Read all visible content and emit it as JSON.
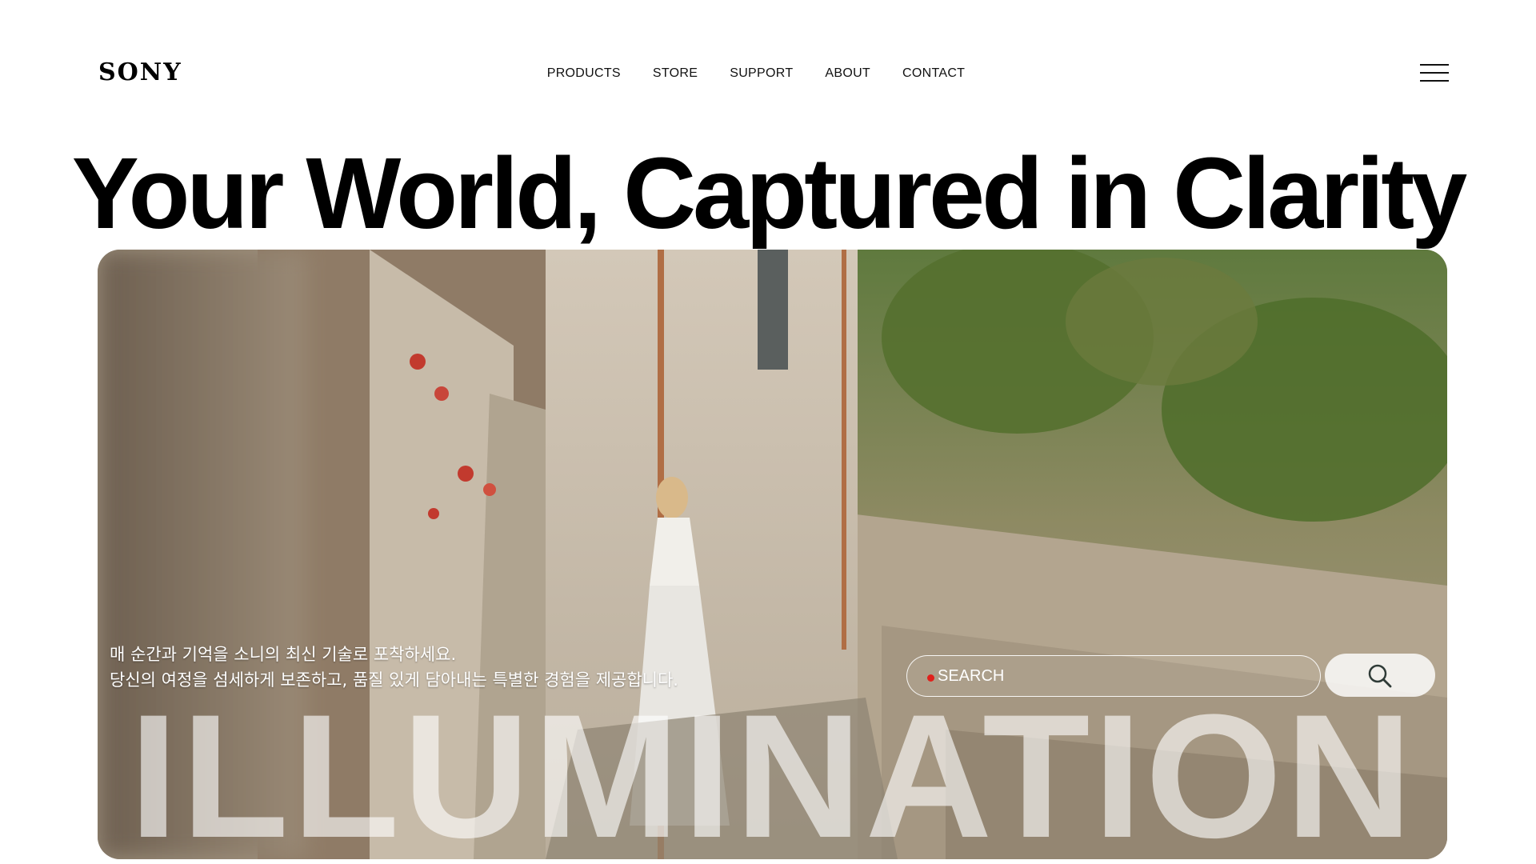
{
  "brand": {
    "logo_text": "SONY"
  },
  "nav": {
    "items": [
      {
        "label": "PRODUCTS"
      },
      {
        "label": "STORE"
      },
      {
        "label": "SUPPORT"
      },
      {
        "label": "ABOUT"
      },
      {
        "label": "CONTACT"
      }
    ],
    "menu_icon": "hamburger-menu-icon"
  },
  "hero": {
    "headline": "Your World, Captured in Clarity",
    "description_line1": "매 순간과 기억을 소니의 최신 기술로 포착하세요.",
    "description_line2": "당신의 여정을 섬세하게 보존하고, 품질 있게 담아내는 특별한 경험을 제공합니다.",
    "search_placeholder": "SEARCH",
    "search_icon": "search-icon",
    "big_word": "ILLUMINATION",
    "image_subject": "woman-walking-stone-alley-photo"
  },
  "colors": {
    "background": "#ffffff",
    "text": "#000000",
    "search_dot": "#e0201b"
  }
}
